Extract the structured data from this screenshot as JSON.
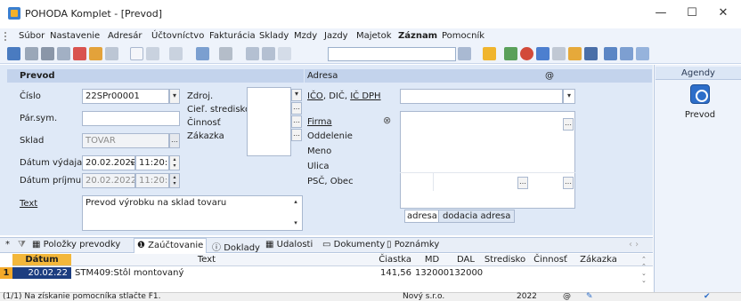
{
  "window": {
    "title": "POHODA Komplet - [Prevod]",
    "minimize": "—",
    "maximize": "☐",
    "close": "✕"
  },
  "menu": [
    "Súbor",
    "Nastavenie",
    "Adresár",
    "Účtovníctvo",
    "Fakturácia",
    "Sklady",
    "Mzdy",
    "Jazdy",
    "Majetok",
    "Záznam",
    "Pomocník"
  ],
  "sidebar": {
    "header": "Agendy",
    "item_label": "Prevod"
  },
  "prevod": {
    "section_title": "Prevod",
    "cislo_label": "Číslo",
    "cislo_value": "22SPr00001",
    "parsym_label": "Pár.sym.",
    "parsym_value": "",
    "sklad_label": "Sklad",
    "sklad_value": "TOVAR",
    "datum_vydaja_label": "Dátum výdaja",
    "datum_vydaja_date": "20.02.2022",
    "datum_vydaja_time": "11:20:0(",
    "datum_prijmu_label": "Dátum príjmu",
    "datum_prijmu_date": "20.02.2022",
    "datum_prijmu_time": "11:20:0(",
    "text_label": "Text",
    "text_value": "Prevod výrobku na sklad tovaru",
    "zdroj_label": "Zdroj.",
    "ciel_label": "Cieľ. stredisko",
    "cinnost_label": "Činnosť",
    "zakazka_label": "Zákazka"
  },
  "adresa": {
    "section_title": "Adresa",
    "at_symbol": "@",
    "ico_label": "IČO",
    "dic_label": "DIČ",
    "icdph_label": "IČ DPH",
    "comma": ",",
    "firma_label": "Firma",
    "oddelenie_label": "Oddelenie",
    "meno_label": "Meno",
    "ulica_label": "Ulica",
    "psc_label": "PSČ, Obec",
    "tab_adresa": "adresa",
    "tab_dodacia": "dodacia adresa"
  },
  "bottom_tabs": [
    "Položky prevodky",
    "Zaúčtovanie",
    "Doklady",
    "Udalosti",
    "Dokumenty",
    "Poznámky"
  ],
  "grid": {
    "headers": [
      "Dátum",
      "Text",
      "Čiastka",
      "MD",
      "DAL",
      "Stredisko",
      "Činnosť",
      "Zákazka"
    ],
    "rows": [
      {
        "num": "1",
        "datum": "20.02.22",
        "text": "STM409:Stôl montovaný",
        "ciastka": "141,56",
        "md": "132000",
        "dal": "132000"
      }
    ]
  },
  "status": {
    "hint": "(1/1) Na získanie pomocníka stlačte F1.",
    "company": "Nový s.r.o.",
    "year": "2022",
    "at": "@"
  },
  "colors": {
    "accent": "#2d6ec9",
    "form_bg": "#dfe9f7",
    "section_bg": "#c3d3ec",
    "row_number_bg": "#f3a92a",
    "date_cell_bg": "#1c3d80"
  }
}
